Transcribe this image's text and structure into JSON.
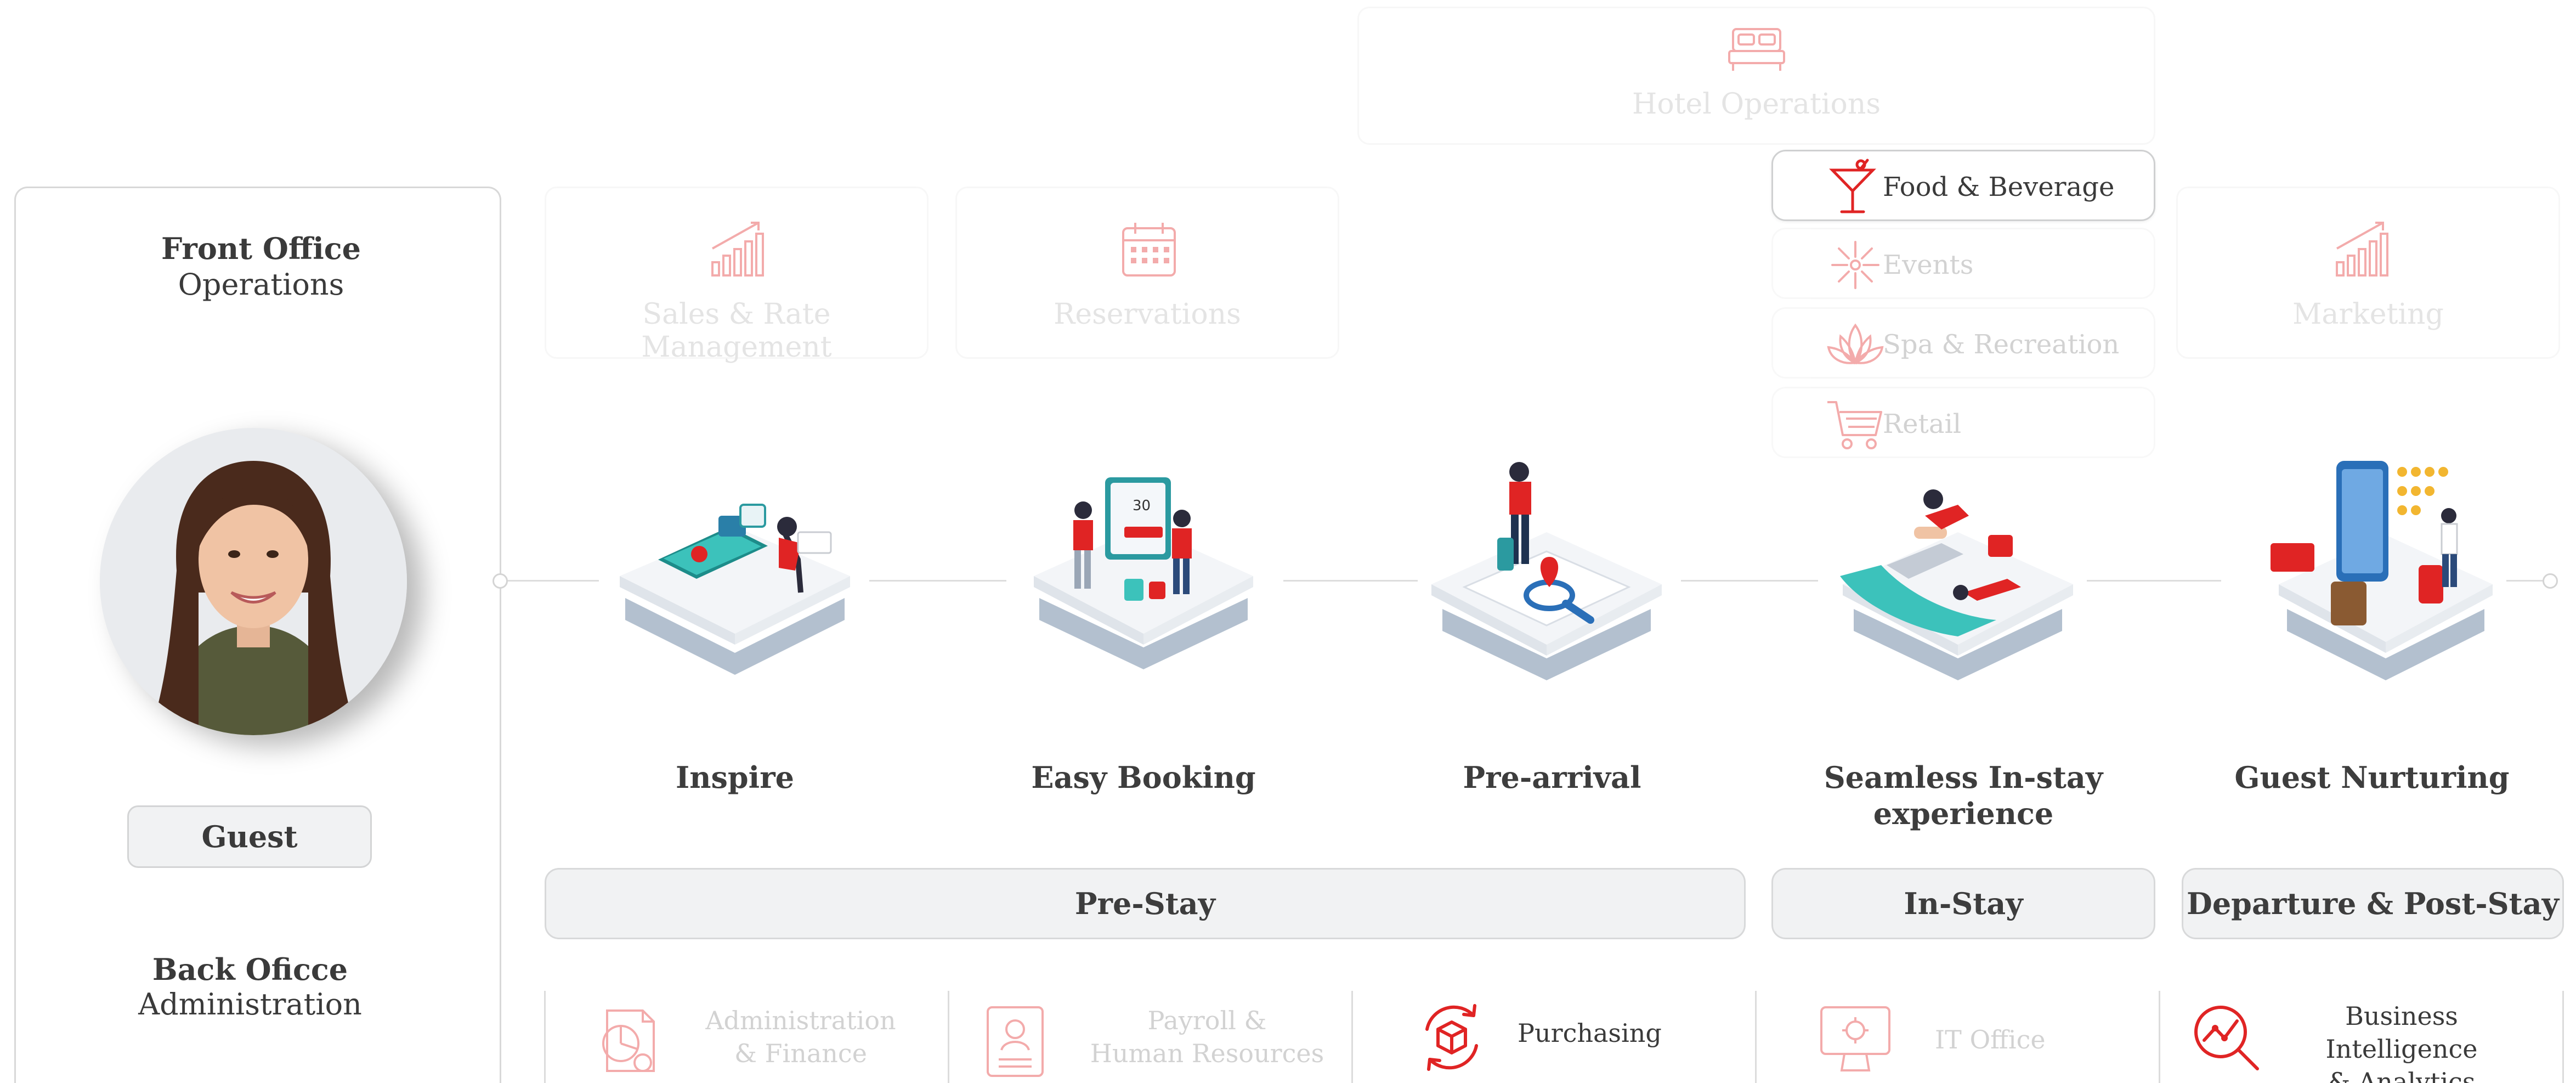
{
  "front_office": {
    "title": "Front Office",
    "subtitle": "Operations"
  },
  "guest_label": "Guest",
  "back_office": {
    "title": "Back Oficce",
    "subtitle": "Administration"
  },
  "hotel_operations": "Hotel Operations",
  "top_modules": {
    "sales": "Sales & Rate Management",
    "reservations": "Reservations",
    "marketing": "Marketing"
  },
  "hotel_menu": {
    "food_beverage": "Food & Beverage",
    "events": "Events",
    "spa": "Spa & Recreation",
    "retail": "Retail"
  },
  "stages": {
    "inspire": "Inspire",
    "easy_booking": "Easy Booking",
    "pre_arrival": "Pre-arrival",
    "in_stay_line1": "Seamless In-stay",
    "in_stay_line2": "experience",
    "guest_nurturing": "Guest Nurturing"
  },
  "phases": {
    "pre_stay": "Pre-Stay",
    "in_stay": "In-Stay",
    "post_stay": "Departure & Post-Stay"
  },
  "back_modules": {
    "admin_line1": "Administration",
    "admin_line2": "& Finance",
    "payroll_line1": "Payroll &",
    "payroll_line2": "Human Resources",
    "purchasing": "Purchasing",
    "it_office": "IT Office",
    "bi_line1": "Business Intelligence",
    "bi_line2": "& Analytics"
  },
  "colors": {
    "accent": "#e02424",
    "border": "#d8d9da",
    "text": "#3a3a3a",
    "faded": "#f3b8b8"
  },
  "icons": [
    "bed-icon",
    "growth-chart-icon",
    "calendar-icon",
    "cocktail-icon",
    "sparkle-icon",
    "lotus-icon",
    "cart-icon",
    "pie-chart-document-icon",
    "id-card-icon",
    "box-cycle-icon",
    "monitor-settings-icon",
    "magnifier-analytics-icon"
  ]
}
